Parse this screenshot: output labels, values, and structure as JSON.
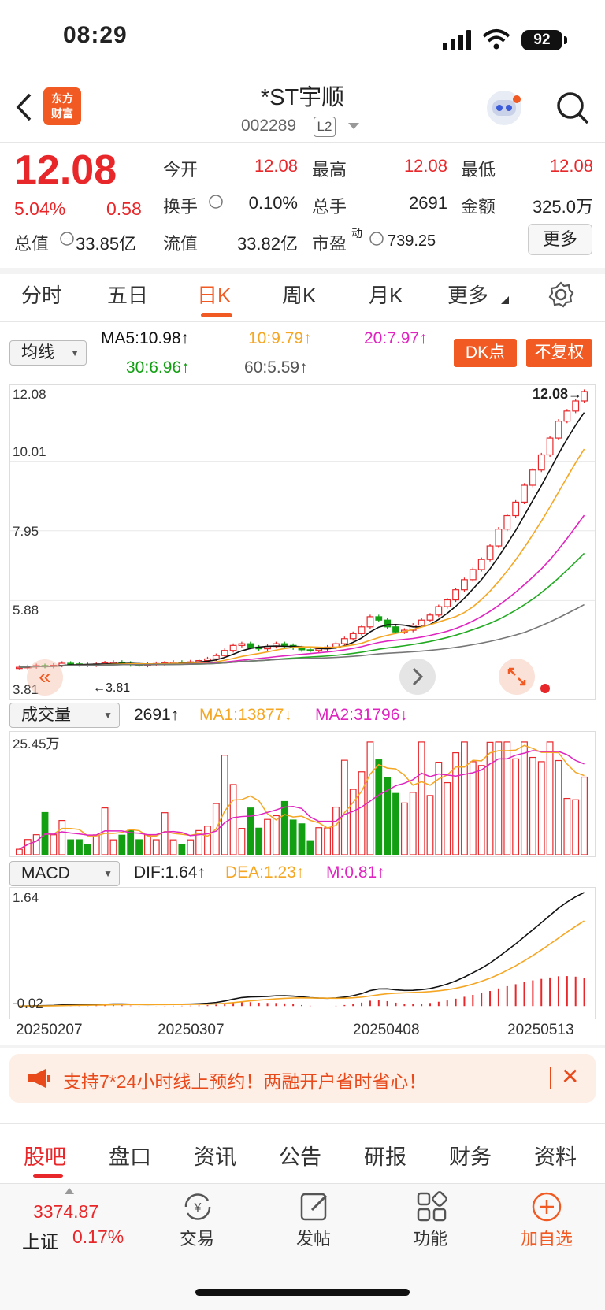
{
  "status": {
    "time": "08:29",
    "battery": "92"
  },
  "header": {
    "title": "*ST宇顺",
    "code": "002289",
    "level": "L2",
    "logo_line1": "东方",
    "logo_line2": "财富"
  },
  "quote": {
    "price": "12.08",
    "change_pct": "5.04%",
    "change": "0.58",
    "open_label": "今开",
    "open": "12.08",
    "high_label": "最高",
    "high": "12.08",
    "low_label": "最低",
    "low": "12.08",
    "turnover_label": "换手",
    "turnover": "0.10%",
    "volume_label": "总手",
    "volume": "2691",
    "amount_label": "金额",
    "amount": "325.0万",
    "mktcap_label": "总值",
    "mktcap": "33.85亿",
    "float_label": "流值",
    "float_cap": "33.82亿",
    "pe_label": "市盈",
    "pe_sup": "动",
    "pe": "739.25",
    "more": "更多"
  },
  "tabs": [
    "分时",
    "五日",
    "日K",
    "周K",
    "月K",
    "更多"
  ],
  "kline": {
    "indicator": "均线",
    "ma5": "MA5:10.98↑",
    "ma10": "10:9.79↑",
    "ma20": "20:7.97↑",
    "ma30": "30:6.96↑",
    "ma60": "60:5.59↑",
    "dk_button": "DK点",
    "fq_button": "不复权",
    "y_labels": [
      "12.08",
      "10.01",
      "7.95",
      "5.88",
      "3.81"
    ],
    "last_price_tag": "12.08→",
    "low_marker": "←3.81"
  },
  "volume": {
    "indicator": "成交量",
    "value": "2691↑",
    "ma1": "MA1:13877↓",
    "ma2": "MA2:31796↓",
    "y_max": "25.45万"
  },
  "macd": {
    "indicator": "MACD",
    "dif": "DIF:1.64↑",
    "dea": "DEA:1.23↑",
    "m": "M:0.81↑",
    "y_max": "1.64",
    "y_min": "-0.02"
  },
  "dates": [
    "20250207",
    "20250307",
    "20250408",
    "20250513"
  ],
  "chart_data": {
    "type": "candlestick",
    "title": "*ST宇顺 日K",
    "xlabel": "",
    "ylabel": "",
    "x_ticks": [
      "20250207",
      "20250307",
      "20250408",
      "20250513"
    ],
    "ylim": [
      3.81,
      12.08
    ],
    "close": [
      3.9,
      3.92,
      3.95,
      3.93,
      3.96,
      4.02,
      4.0,
      3.98,
      3.97,
      4.0,
      4.03,
      4.05,
      4.02,
      3.98,
      3.96,
      3.99,
      4.01,
      4.03,
      4.05,
      4.04,
      4.06,
      4.1,
      4.15,
      4.25,
      4.4,
      4.55,
      4.6,
      4.5,
      4.45,
      4.52,
      4.6,
      4.55,
      4.48,
      4.42,
      4.4,
      4.45,
      4.5,
      4.6,
      4.75,
      4.9,
      5.1,
      5.4,
      5.3,
      5.1,
      4.95,
      5.0,
      5.15,
      5.3,
      5.45,
      5.7,
      5.9,
      6.2,
      6.5,
      6.8,
      7.1,
      7.5,
      8.0,
      8.4,
      8.8,
      9.3,
      9.75,
      10.2,
      10.7,
      11.2,
      11.5,
      11.8,
      12.08
    ],
    "ma5_last": 10.98,
    "ma10_last": 9.79,
    "ma20_last": 7.97,
    "ma30_last": 6.96,
    "ma60_last": 5.59,
    "volume_max_wan": 25.45,
    "volume_last": 2691,
    "macd": {
      "dif_last": 1.64,
      "dea_last": 1.23,
      "m_last": 0.81,
      "ylim": [
        -0.02,
        1.64
      ]
    }
  },
  "promo": {
    "text": "支持7*24小时线上预约！两融开户省时省心！"
  },
  "bottom_tabs": [
    "股吧",
    "盘口",
    "资讯",
    "公告",
    "研报",
    "财务",
    "资料"
  ],
  "bottom_bar": {
    "index_value": "3374.87",
    "index_name": "上证",
    "index_change": "0.17%",
    "trade": "交易",
    "post": "发帖",
    "func": "功能",
    "add": "加自选"
  },
  "colors": {
    "up": "#e8272a",
    "down": "#12a012",
    "accent": "#f15a22",
    "ma5": "#111111",
    "ma10": "#f5a623",
    "ma20": "#e024c0",
    "ma30": "#22aa22",
    "ma60": "#777777"
  }
}
